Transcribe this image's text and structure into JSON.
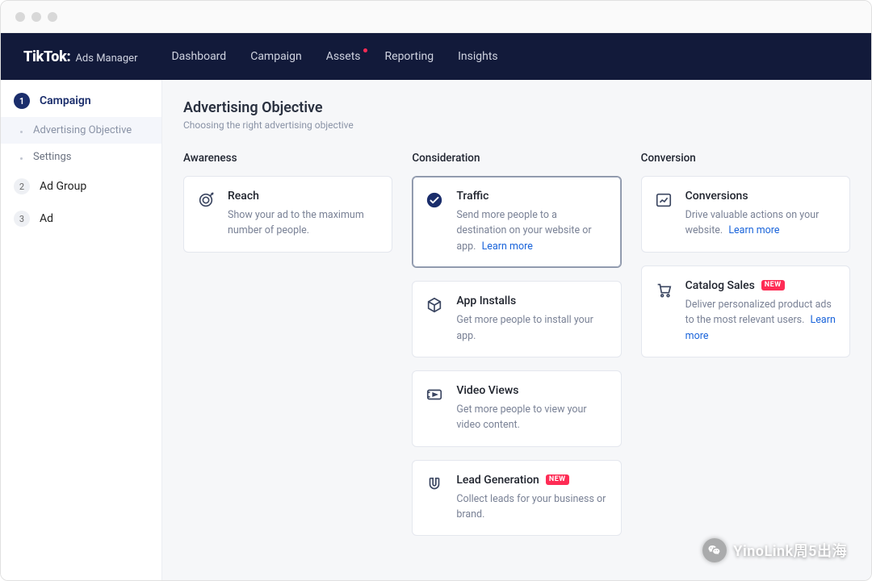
{
  "brand": {
    "logo": "TikTok:",
    "product": "Ads Manager"
  },
  "nav": {
    "items": [
      {
        "label": "Dashboard"
      },
      {
        "label": "Campaign"
      },
      {
        "label": "Assets",
        "hot": true
      },
      {
        "label": "Reporting"
      },
      {
        "label": "Insights"
      }
    ]
  },
  "sidebar": {
    "steps": [
      {
        "num": "1",
        "label": "Campaign",
        "active": true,
        "sub": [
          {
            "label": "Advertising Objective",
            "current": true
          },
          {
            "label": "Settings"
          }
        ]
      },
      {
        "num": "2",
        "label": "Ad Group"
      },
      {
        "num": "3",
        "label": "Ad"
      }
    ]
  },
  "page": {
    "title": "Advertising Objective",
    "subtitle": "Choosing the right advertising objective"
  },
  "columns": {
    "awareness": {
      "head": "Awareness",
      "cards": [
        {
          "title": "Reach",
          "desc": "Show your ad to the maximum number of people."
        }
      ]
    },
    "consideration": {
      "head": "Consideration",
      "cards": [
        {
          "title": "Traffic",
          "desc": "Send more people to a destination on your website or app.",
          "learn_more": "Learn more",
          "selected": true
        },
        {
          "title": "App Installs",
          "desc": "Get more people to install your app."
        },
        {
          "title": "Video Views",
          "desc": "Get more people to view your video content."
        },
        {
          "title": "Lead Generation",
          "desc": "Collect leads for your business or brand.",
          "new_badge": "NEW"
        }
      ]
    },
    "conversion": {
      "head": "Conversion",
      "cards": [
        {
          "title": "Conversions",
          "desc": "Drive valuable actions on your website.",
          "learn_more": "Learn more"
        },
        {
          "title": "Catalog Sales",
          "desc": "Deliver personalized product ads to the most relevant users.",
          "learn_more": "Learn more",
          "new_badge": "NEW"
        }
      ]
    }
  },
  "watermark": {
    "text": "YinoLink周5出海"
  }
}
